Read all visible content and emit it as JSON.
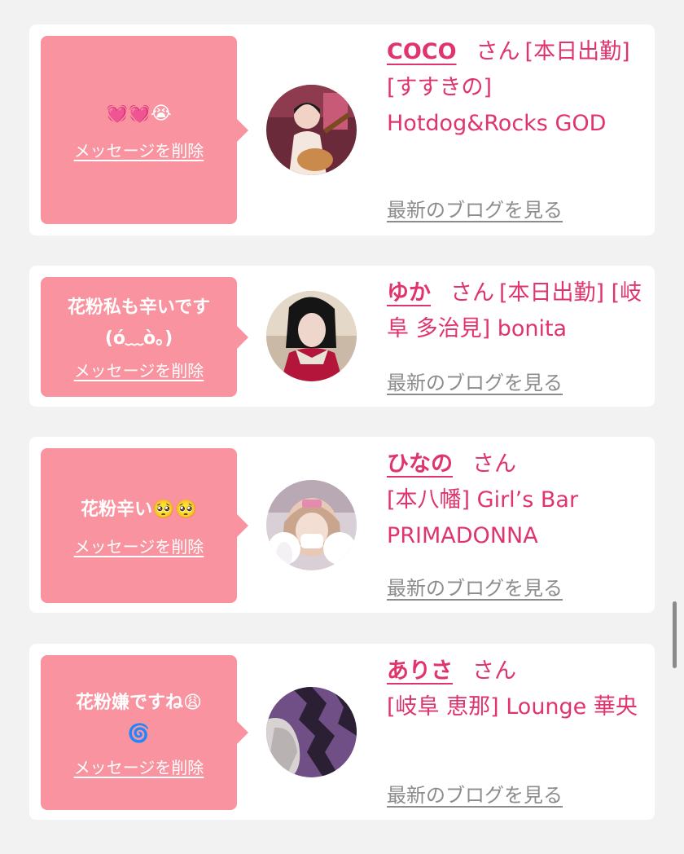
{
  "cards": [
    {
      "message": "💓💓😭",
      "delete_label": "メッセージを削除",
      "name": "COCO",
      "san": "さん",
      "details": "[本日出勤] [すすきの] Hotdog&Rocks GOD",
      "blog_label": "最新のブログを見る"
    },
    {
      "message": "花粉私も辛いです\n(ó﹏ò｡)",
      "delete_label": "メッセージを削除",
      "name": "ゆか",
      "san": "さん",
      "details": "[本日出勤] [岐阜 多治見] bonita",
      "blog_label": "最新のブログを見る"
    },
    {
      "message": "花粉辛い🥺🥺",
      "delete_label": "メッセージを削除",
      "name": "ひなの",
      "san": "さん",
      "details": "[本八幡] Girl’s Bar PRIMADONNA",
      "blog_label": "最新のブログを見る"
    },
    {
      "message": "花粉嫌ですね😩\n🌀",
      "delete_label": "メッセージを削除",
      "name": "ありさ",
      "san": "さん",
      "details": "[岐阜 恵那] Lounge 華央",
      "blog_label": "最新のブログを見る"
    }
  ],
  "colors": {
    "bubble": "#f8939f",
    "accent": "#e0346c",
    "link_gray": "#8c8c8c",
    "background": "#f2f2f2"
  }
}
